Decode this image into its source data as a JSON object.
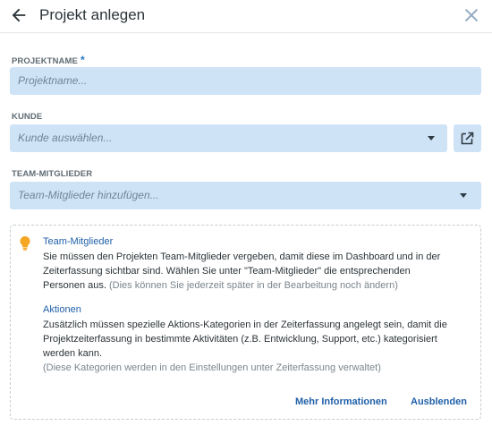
{
  "header": {
    "title": "Projekt anlegen",
    "back_icon": "arrow-left-icon",
    "close_icon": "close-icon"
  },
  "form": {
    "project_name": {
      "label": "PROJEKTNAME",
      "required_mark": "*",
      "placeholder": "Projektname...",
      "value": ""
    },
    "customer": {
      "label": "KUNDE",
      "placeholder": "Kunde auswählen...",
      "value": "",
      "open_icon": "open-in-new-icon"
    },
    "team": {
      "label": "TEAM-MITGLIEDER",
      "placeholder": "Team-Mitglieder hinzufügen...",
      "value": ""
    }
  },
  "info": {
    "icon": "lightbulb-icon",
    "team_title": "Team-Mitglieder",
    "team_line1": "Sie müssen den Projekten Team-Mitglieder vergeben, damit diese im Dashboard und in der",
    "team_line2": "Zeiterfassung sichtbar sind. Wählen Sie unter \"Team-Mitglieder\" die entsprechenden",
    "team_line3": "Personen aus.",
    "team_note": "(Dies können Sie jederzeit später in der Bearbeitung noch ändern)",
    "actions_title": "Aktionen",
    "actions_line1": "Zusätzlich müssen spezielle Aktions-Kategorien in der Zeiterfassung angelegt sein, damit die",
    "actions_line2": "Projektzeiterfassung in bestimmte Aktivitäten (z.B. Entwicklung, Support, etc.) kategorisiert",
    "actions_line3": "werden kann.",
    "actions_note": "(Diese Kategorien werden in den Einstellungen unter Zeiterfassung verwaltet)",
    "more_label": "Mehr Informationen",
    "hide_label": "Ausblenden"
  },
  "colors": {
    "field_bg": "#cfe3f7",
    "accent": "#1f5fa8",
    "bulb": "#f5a623"
  }
}
